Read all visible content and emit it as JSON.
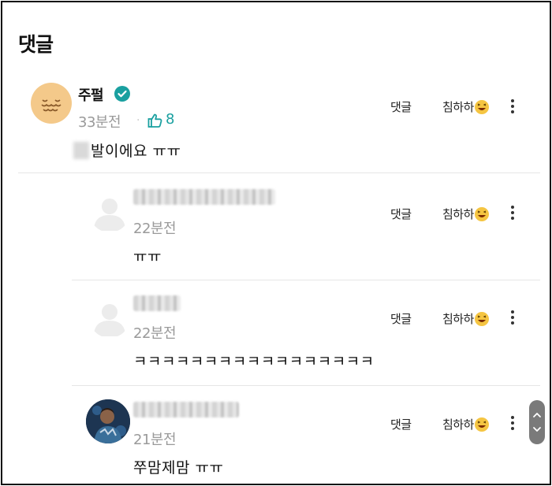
{
  "section_title": "댓글",
  "actions": {
    "reply_label": "댓글",
    "react_label": "침하하"
  },
  "comments": [
    {
      "author": "주펄",
      "verified": true,
      "time": "33분전",
      "likes": "8",
      "text": "발이에요 ㅠㅠ"
    },
    {
      "author": "",
      "time": "22분전",
      "text": "ㅠㅠ"
    },
    {
      "author": "",
      "time": "22분전",
      "text": "ㅋㅋㅋㅋㅋㅋㅋㅋㅋㅋㅋㅋㅋㅋㅋㅋㅋ"
    },
    {
      "author": "",
      "time": "21분전",
      "text": "쭈맘제맘 ㅠㅠ"
    }
  ],
  "colors": {
    "accent": "#1aa0a0",
    "muted": "#9a9a9a",
    "avatar_sun": "#f4c98a"
  },
  "icons": [
    "verified-check-icon",
    "thumbs-up-icon",
    "laughing-emoji-icon",
    "more-vertical-icon",
    "scroll-up-icon",
    "scroll-down-icon"
  ]
}
